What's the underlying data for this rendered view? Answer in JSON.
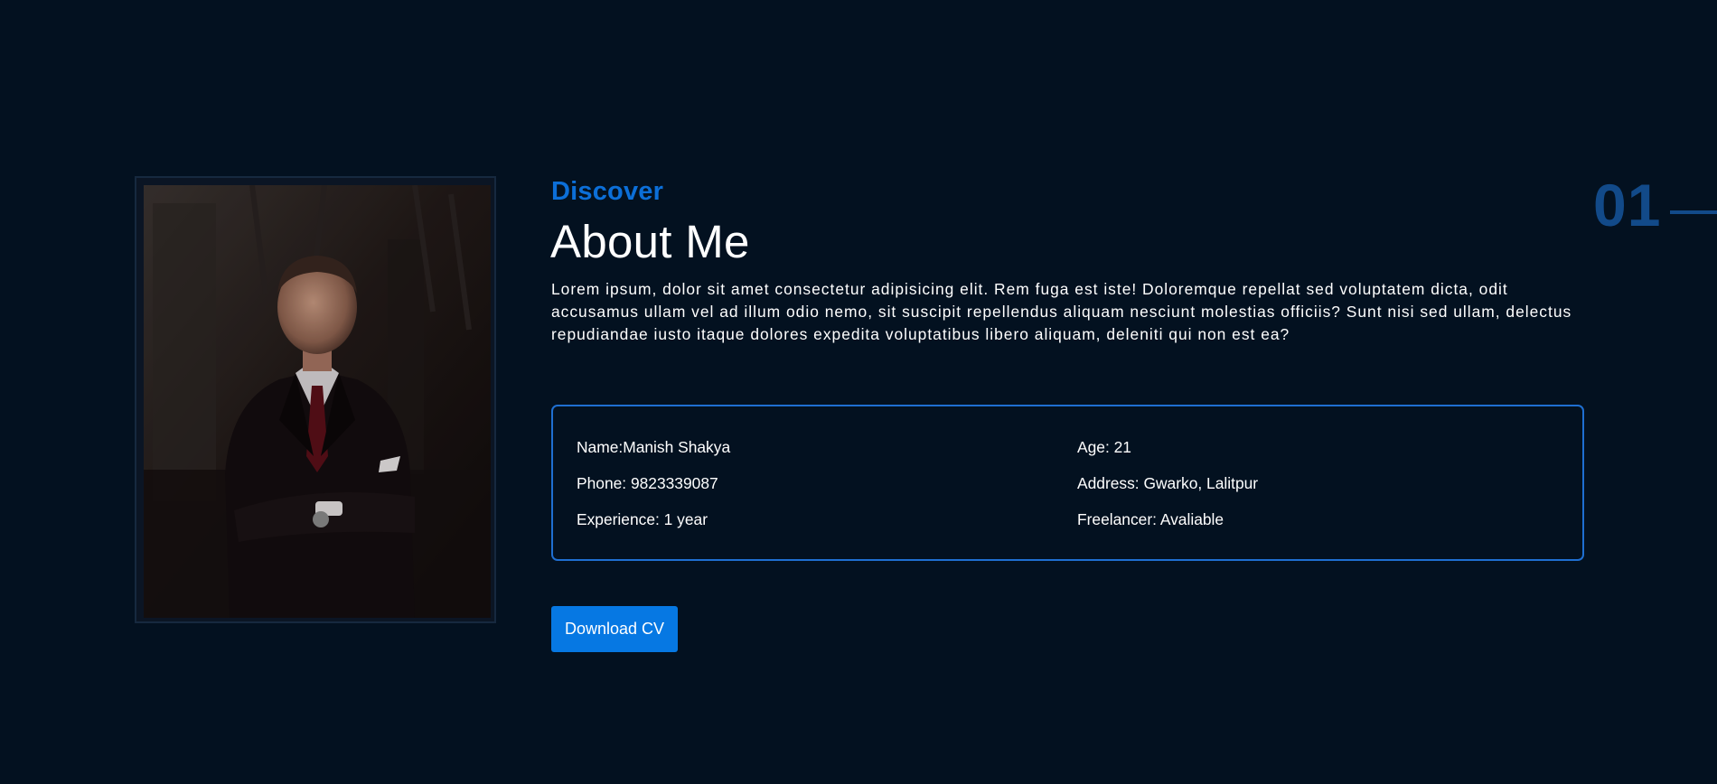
{
  "about": {
    "eyebrow": "Discover",
    "title": "About Me",
    "bio": "Lorem ipsum, dolor sit amet consectetur adipisicing elit. Rem fuga est iste! Doloremque repellat sed voluptatem dicta, odit accusamus ullam vel ad illum odio nemo, sit suscipit repellendus aliquam nesciunt molestias officiis? Sunt nisi sed ullam, delectus repudiandae iusto itaque dolores expedita voluptatibus libero aliquam, deleniti qui non est ea?"
  },
  "info": {
    "name": "Name:Manish Shakya",
    "age": "Age: 21",
    "phone": "Phone: 9823339087",
    "address": "Address: Gwarko, Lalitpur",
    "experience": "Experience: 1 year",
    "freelancer": "Freelancer: Avaliable"
  },
  "button": {
    "download_label": "Download CV"
  },
  "section": {
    "number": "01"
  },
  "colors": {
    "background": "#031120",
    "accent": "#0c6fd8",
    "button": "#0678e3",
    "info_border": "#1f6fd1",
    "section_number": "#124a89"
  }
}
